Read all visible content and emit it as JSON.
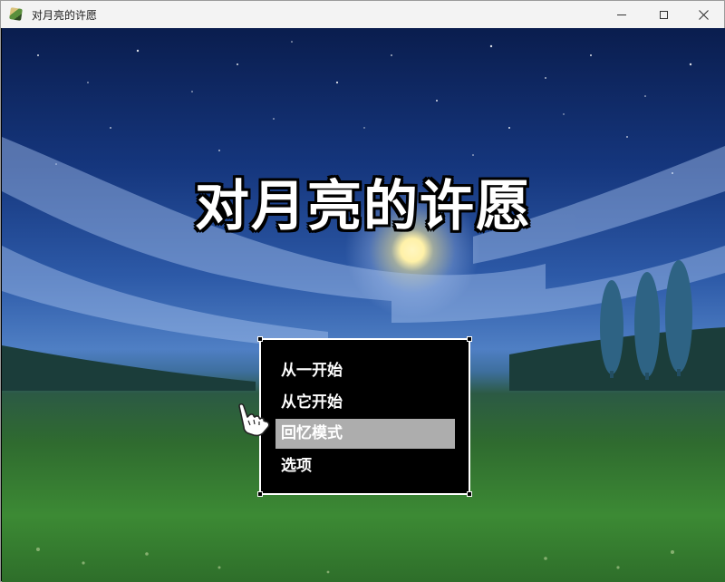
{
  "window": {
    "title": "对月亮的许愿",
    "buttons": {
      "minimize": "minimize-icon",
      "maximize": "maximize-icon",
      "close": "close-icon"
    }
  },
  "game": {
    "title": "对月亮的许愿",
    "menu": {
      "items": [
        {
          "label": "从一开始"
        },
        {
          "label": "从它开始"
        },
        {
          "label": "回忆模式"
        },
        {
          "label": "选项"
        }
      ],
      "selected_index": 2
    },
    "cursor": "pointing-hand-icon",
    "colors": {
      "menu_bg": "#000000",
      "menu_border": "#ffffff",
      "selection": "#adadad",
      "title_text": "#ffffff"
    }
  }
}
